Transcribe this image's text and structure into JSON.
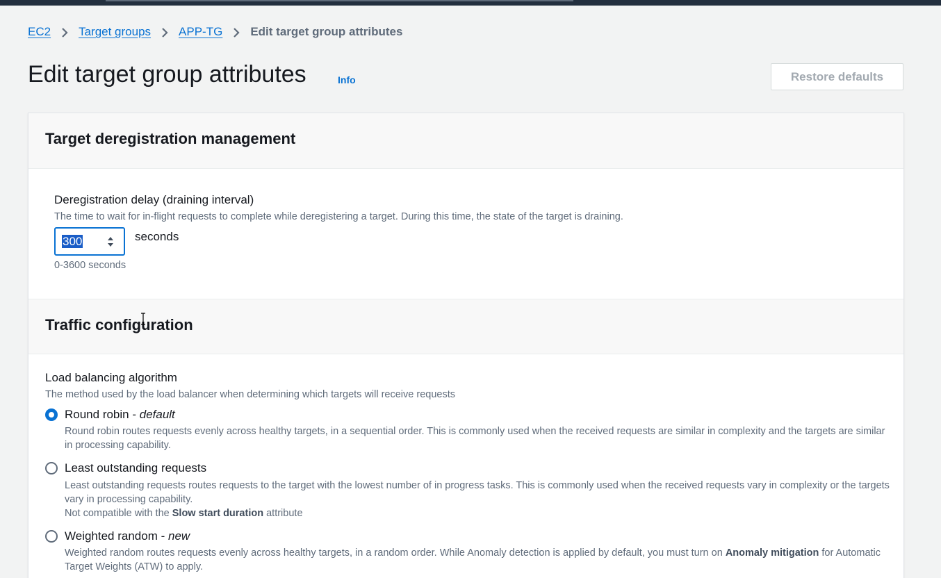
{
  "breadcrumb": {
    "items": [
      "EC2",
      "Target groups",
      "APP-TG"
    ],
    "current": "Edit target group attributes"
  },
  "header": {
    "title": "Edit target group attributes",
    "info": "Info",
    "restore_button": "Restore defaults"
  },
  "deregistration": {
    "section_title": "Target deregistration management",
    "label": "Deregistration delay (draining interval)",
    "description": "The time to wait for in-flight requests to complete while deregistering a target. During this time, the state of the target is draining.",
    "value": "300",
    "unit": "seconds",
    "constraint": "0-3600 seconds"
  },
  "traffic": {
    "section_title": "Traffic configuration",
    "label": "Load balancing algorithm",
    "description": "The method used by the load balancer when determining which targets will receive requests",
    "options": [
      {
        "label": "Round robin",
        "suffix": "default",
        "checked": true,
        "description": "Round robin routes requests evenly across healthy targets, in a sequential order. This is commonly used when the received requests are similar in complexity and the targets are similar in processing capability."
      },
      {
        "label": "Least outstanding requests",
        "suffix": "",
        "checked": false,
        "description": "Least outstanding requests routes requests to the target with the lowest number of in progress tasks. This is commonly used when the received requests vary in complexity or the targets vary in processing capability.",
        "note_prefix": "Not compatible with the",
        "note_bold": "Slow start duration",
        "note_suffix": "attribute"
      },
      {
        "label": "Weighted random",
        "suffix": "new",
        "checked": false,
        "description_prefix": "Weighted random routes requests evenly across healthy targets, in a random order. While Anomaly detection is applied by default, you must turn on",
        "description_bold": "Anomaly mitigation",
        "description_suffix": "for Automatic Target Weights (ATW) to apply."
      }
    ]
  },
  "colors": {
    "link": "#0972d3",
    "text": "#16191f",
    "muted": "#5f6b7a",
    "page_bg": "#f2f3f3"
  }
}
